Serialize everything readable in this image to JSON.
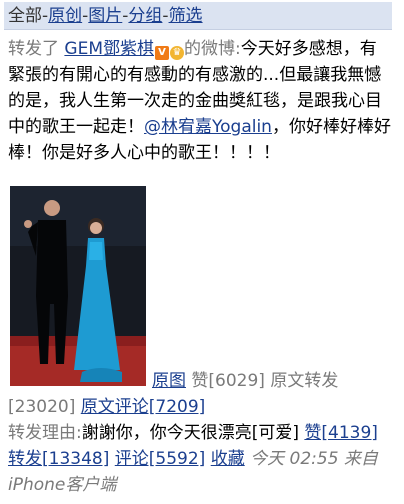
{
  "nav": {
    "all": "全部",
    "sep": "-",
    "original": "原创",
    "images": "图片",
    "groups": "分组",
    "filter": "筛选"
  },
  "post": {
    "repost_prefix": "转发了",
    "author": "GEM鄧紫棋",
    "badge_v": "V",
    "badge_crown": "♛",
    "weibo_suffix": "的微博:",
    "text_part1": "今天好多感想，有緊張的有開心的有感動的有感激的...但最讓我無憾的是，我人生第一次走的金曲獎紅毯，是跟我心目中的歌王一起走！",
    "mention": "@林宥嘉Yogalin",
    "text_part2": "，你好棒好棒好棒！你是好多人心中的歌王！！！！"
  },
  "actions": {
    "original_image": "原图",
    "likes_label": "赞[6029]",
    "orig_repost_label": "原文转发[23020]",
    "orig_comments": "原文评论[7209]"
  },
  "repost": {
    "reason_label": "转发理由:",
    "reason_text": "謝謝你，你今天很漂亮[可爱]",
    "like": "赞[4139]",
    "forward": "转发[13348]",
    "comment": "评论[5592]",
    "favorite": "收藏",
    "time": "今天 02:55",
    "source": "来自iPhone客户端"
  }
}
